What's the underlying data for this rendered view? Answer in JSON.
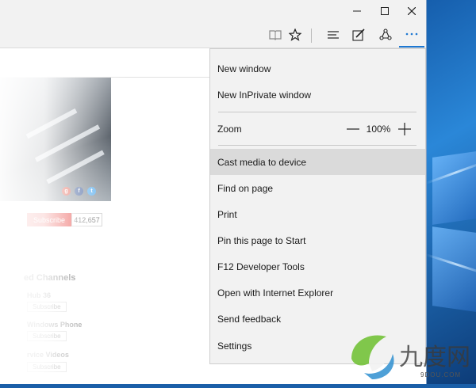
{
  "window": {
    "controls": [
      "minimize-icon",
      "maximize-icon",
      "close-icon"
    ]
  },
  "toolbar": {
    "icons": [
      "reading-view-icon",
      "favorites-star-icon",
      "hub-icon",
      "web-note-icon",
      "share-icon",
      "more-actions-icon"
    ]
  },
  "page": {
    "subscribe_label": "Subscribe",
    "subscriber_count": "412,657",
    "section_title": "ed Channels",
    "channels": [
      {
        "name": "Hub 36",
        "button": "Subscribe"
      },
      {
        "name": "Windows Phone",
        "button": "Subscribe"
      },
      {
        "name": "rvice Videos",
        "button": "Subscribe"
      }
    ]
  },
  "menu": {
    "items": [
      {
        "label": "New window"
      },
      {
        "label": "New InPrivate window"
      },
      {
        "label": "Zoom"
      },
      {
        "label": "Cast media to device"
      },
      {
        "label": "Find on page"
      },
      {
        "label": "Print"
      },
      {
        "label": "Pin this page to Start"
      },
      {
        "label": "F12 Developer Tools"
      },
      {
        "label": "Open with Internet Explorer"
      },
      {
        "label": "Send feedback"
      },
      {
        "label": "Settings"
      }
    ],
    "zoom": {
      "minus": "—",
      "value": "100%",
      "plus": "+"
    },
    "highlighted": "Cast media to device"
  },
  "watermark": {
    "text": "九度网",
    "url": "9DOU.COM"
  },
  "colors": {
    "accent": "#1e78d2",
    "menu_bg": "#f2f2f2",
    "menu_hover": "#dadada",
    "subscribe_red": "#e6302b"
  }
}
